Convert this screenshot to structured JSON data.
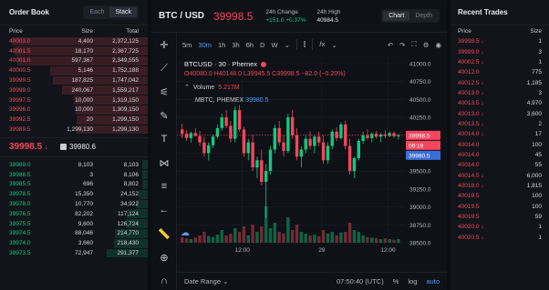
{
  "orderbook": {
    "title": "Order Book",
    "tabs": [
      "Each",
      "Stack"
    ],
    "active_tab": 1,
    "columns": {
      "price": "Price",
      "size": "Size",
      "total": "Total"
    },
    "asks": [
      {
        "price": "40003.0",
        "size": "4,400",
        "total": "2,372,125",
        "fill": 0.92
      },
      {
        "price": "40001.5",
        "size": "18,170",
        "total": "2,367,725",
        "fill": 0.9
      },
      {
        "price": "40001.0",
        "size": "597,367",
        "total": "2,349,555",
        "fill": 0.88
      },
      {
        "price": "40000.5",
        "size": "5,146",
        "total": "1,752,188",
        "fill": 0.66
      },
      {
        "price": "39999.5",
        "size": "187,825",
        "total": "1,747,042",
        "fill": 0.64
      },
      {
        "price": "39999.0",
        "size": "240,067",
        "total": "1,559,217",
        "fill": 0.58
      },
      {
        "price": "39997.5",
        "size": "10,000",
        "total": "1,319,150",
        "fill": 0.5
      },
      {
        "price": "39996.0",
        "size": "10,000",
        "total": "1,309,150",
        "fill": 0.49
      },
      {
        "price": "39992.5",
        "size": "20",
        "total": "1,299,150",
        "fill": 0.48
      },
      {
        "price": "39989.5",
        "size": "1,299,130",
        "total": "1,299,130",
        "fill": 0.48
      }
    ],
    "last_price": "39998.5",
    "last_dir": "↓",
    "mark_price": "39980.6",
    "bids": [
      {
        "price": "39989.0",
        "size": "8,103",
        "total": "8,103",
        "fill": 0.04
      },
      {
        "price": "39988.5",
        "size": "3",
        "total": "8,106",
        "fill": 0.04
      },
      {
        "price": "39985.5",
        "size": "696",
        "total": "8,802",
        "fill": 0.04
      },
      {
        "price": "39978.5",
        "size": "15,350",
        "total": "24,152",
        "fill": 0.06
      },
      {
        "price": "39978.0",
        "size": "10,770",
        "total": "34,922",
        "fill": 0.08
      },
      {
        "price": "39976.5",
        "size": "82,202",
        "total": "117,124",
        "fill": 0.14
      },
      {
        "price": "39975.5",
        "size": "9,600",
        "total": "126,724",
        "fill": 0.15
      },
      {
        "price": "39974.5",
        "size": "88,046",
        "total": "214,770",
        "fill": 0.22
      },
      {
        "price": "39974.0",
        "size": "3,660",
        "total": "218,430",
        "fill": 0.23
      },
      {
        "price": "39973.5",
        "size": "72,947",
        "total": "291,377",
        "fill": 0.28
      }
    ]
  },
  "header": {
    "symbol": "BTC / USD",
    "last_price": "39998.5",
    "change_label": "24h Change",
    "change_value": "+151.0 +0.37%",
    "high_label": "24h High",
    "high_value": "40984.5",
    "view_tabs": [
      "Chart",
      "Depth"
    ],
    "active_view": 0
  },
  "toolbar": {
    "timeframes": [
      "5m",
      "30m",
      "1h",
      "3h",
      "6h",
      "D",
      "W"
    ],
    "active_timeframe": 1
  },
  "chart": {
    "symbol_line": "BTCUSD · 30 · Phemex",
    "ohlc": {
      "o": "O40080.0",
      "h": "H40148.0",
      "l": "L39945.5",
      "c": "C39998.5",
      "chg": "−82.0 (−0.20%)"
    },
    "volume_label": "Volume",
    "volume_value": "5.217M",
    "index_label": ".MBTC, PHEMEX",
    "index_value": "39980.5",
    "price_tag": "39998.5",
    "countdown": "09:19",
    "index_tag": "39980.5",
    "colors": {
      "up": "#0ecb81",
      "down": "#f6465d",
      "blue": "#3a6fd8"
    }
  },
  "chart_data": {
    "type": "candlestick",
    "title": "",
    "xlabel": "",
    "ylabel": "",
    "x_ticks": [
      "12:00",
      "29",
      "12:00"
    ],
    "y_ticks": [
      "41000.0",
      "40750.0",
      "40500.0",
      "40250.0",
      "40000.0",
      "39750.0",
      "39500.0",
      "39250.0",
      "39000.0",
      "38750.0",
      "38500.0"
    ],
    "ylim": [
      38500,
      41100
    ],
    "candles": [
      [
        40080,
        40160,
        39960,
        40020
      ],
      [
        40020,
        40070,
        39920,
        39960
      ],
      [
        39960,
        40050,
        39900,
        40030
      ],
      [
        40030,
        40100,
        39980,
        39990
      ],
      [
        39990,
        40060,
        39850,
        39900
      ],
      [
        39900,
        39980,
        39700,
        39750
      ],
      [
        39750,
        39900,
        39650,
        39860
      ],
      [
        39860,
        40010,
        39820,
        39980
      ],
      [
        39980,
        40150,
        39950,
        40100
      ],
      [
        40100,
        40300,
        40060,
        40250
      ],
      [
        40250,
        40350,
        40100,
        40130
      ],
      [
        40130,
        40200,
        39900,
        39950
      ],
      [
        39950,
        40400,
        39900,
        40350
      ],
      [
        40350,
        40420,
        40050,
        40080
      ],
      [
        40080,
        40120,
        39700,
        39750
      ],
      [
        39750,
        39950,
        39650,
        39900
      ],
      [
        39900,
        40000,
        39500,
        39550
      ],
      [
        39550,
        39700,
        39400,
        39650
      ],
      [
        39650,
        39800,
        39300,
        39350
      ],
      [
        39350,
        39600,
        38850,
        39500
      ],
      [
        39500,
        39850,
        39450,
        39800
      ],
      [
        39800,
        40150,
        39750,
        40100
      ],
      [
        40100,
        40200,
        39850,
        39900
      ],
      [
        39900,
        40000,
        39700,
        39780
      ],
      [
        39780,
        40300,
        39750,
        40250
      ],
      [
        40250,
        40350,
        39950,
        40000
      ],
      [
        40000,
        40100,
        39650,
        39700
      ],
      [
        39700,
        39850,
        39550,
        39800
      ],
      [
        39800,
        40000,
        39750,
        39950
      ],
      [
        39950,
        40050,
        39800,
        39850
      ],
      [
        39850,
        40000,
        39750,
        39980
      ],
      [
        39980,
        40050,
        39850,
        39900
      ],
      [
        39900,
        40000,
        39600,
        39650
      ],
      [
        39650,
        39900,
        39600,
        39850
      ],
      [
        39850,
        40080,
        39800,
        40050
      ],
      [
        40050,
        40110,
        39920,
        39960
      ],
      [
        39960,
        40180,
        39940,
        40150
      ],
      [
        40150,
        40200,
        39800,
        39850
      ],
      [
        39850,
        39950,
        39450,
        39500
      ],
      [
        39500,
        39700,
        39400,
        39680
      ],
      [
        39680,
        39950,
        39650,
        39920
      ],
      [
        39920,
        40050,
        39880,
        40000
      ],
      [
        40000,
        40080,
        39940,
        39960
      ],
      [
        39960,
        40040,
        39900,
        40020
      ],
      [
        40020,
        40060,
        39950,
        39980
      ],
      [
        39980,
        40030,
        39900,
        40010
      ],
      [
        40010,
        40070,
        39960,
        39990
      ],
      [
        39990,
        40050,
        39970,
        40030
      ],
      [
        40030,
        40050,
        39960,
        39985
      ],
      [
        39985,
        40020,
        39940,
        39998.5
      ]
    ],
    "volumes": [
      0.15,
      0.12,
      0.1,
      0.14,
      0.2,
      0.3,
      0.18,
      0.16,
      0.22,
      0.35,
      0.2,
      0.25,
      0.4,
      0.3,
      0.45,
      0.2,
      0.5,
      0.3,
      0.45,
      1.0,
      0.4,
      0.55,
      0.3,
      0.25,
      0.7,
      0.35,
      0.5,
      0.3,
      0.25,
      0.2,
      0.22,
      0.18,
      0.35,
      0.25,
      0.3,
      0.2,
      0.28,
      0.3,
      0.55,
      0.35,
      0.3,
      0.2,
      0.15,
      0.14,
      0.12,
      0.1,
      0.12,
      0.1,
      0.08,
      0.1
    ]
  },
  "bottombar": {
    "date_range": "Date Range",
    "time": "07:50:40 (UTC)",
    "pct": "%",
    "log": "log",
    "auto": "auto"
  },
  "trades": {
    "title": "Recent Trades",
    "columns": {
      "price": "Price",
      "size": "Size"
    },
    "rows": [
      {
        "price": "39998.5",
        "dir": "↓",
        "size": "1",
        "side": "red"
      },
      {
        "price": "39999.0",
        "dir": "↓",
        "size": "3",
        "side": "red"
      },
      {
        "price": "40002.5",
        "dir": "↓",
        "size": "1",
        "side": "red"
      },
      {
        "price": "40012.0",
        "dir": "",
        "size": "775",
        "side": "red"
      },
      {
        "price": "40012.5",
        "dir": "↓",
        "size": "1,185",
        "side": "red"
      },
      {
        "price": "40013.0",
        "dir": "↓",
        "size": "3",
        "side": "red"
      },
      {
        "price": "40013.5",
        "dir": "↓",
        "size": "4,970",
        "side": "red"
      },
      {
        "price": "40013.0",
        "dir": "↓",
        "size": "3,600",
        "side": "red"
      },
      {
        "price": "40013.5",
        "dir": "↓",
        "size": "2",
        "side": "red"
      },
      {
        "price": "40014.0",
        "dir": "↓",
        "size": "17",
        "side": "red"
      },
      {
        "price": "40014.0",
        "dir": "",
        "size": "100",
        "side": "red"
      },
      {
        "price": "40014.0",
        "dir": "",
        "size": "45",
        "side": "red"
      },
      {
        "price": "40014.0",
        "dir": "",
        "size": "55",
        "side": "red"
      },
      {
        "price": "40014.5",
        "dir": "↓",
        "size": "6,000",
        "side": "red"
      },
      {
        "price": "40018.0",
        "dir": "↓",
        "size": "1,815",
        "side": "red"
      },
      {
        "price": "40019.5",
        "dir": "",
        "size": "100",
        "side": "red"
      },
      {
        "price": "40019.5",
        "dir": "",
        "size": "100",
        "side": "red"
      },
      {
        "price": "40019.5",
        "dir": "",
        "size": "59",
        "side": "red"
      },
      {
        "price": "40020.0",
        "dir": "↓",
        "size": "1",
        "side": "red"
      },
      {
        "price": "40020.5",
        "dir": "↓",
        "size": "1",
        "side": "red"
      }
    ]
  }
}
